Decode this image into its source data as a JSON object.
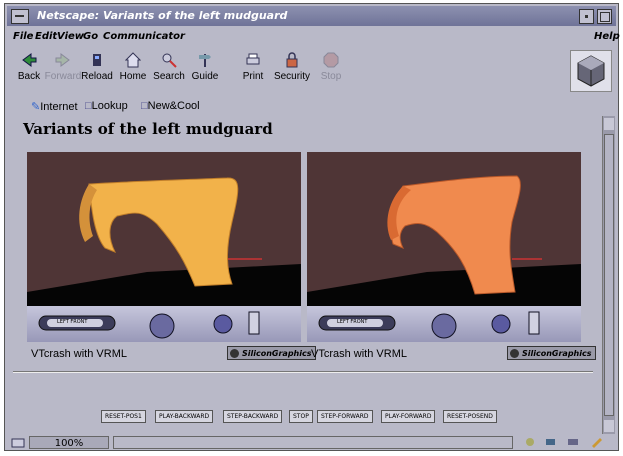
{
  "window": {
    "title": "Netscape: Variants of the left mudguard"
  },
  "menu": {
    "file": "File",
    "edit": "Edit",
    "view": "View",
    "go": "Go",
    "communicator": "Communicator",
    "help": "Help"
  },
  "toolbar": {
    "back": "Back",
    "forward": "Forward",
    "reload": "Reload",
    "home": "Home",
    "search": "Search",
    "guide": "Guide",
    "print": "Print",
    "security": "Security",
    "stop": "Stop"
  },
  "personal_toolbar": {
    "internet": "Internet",
    "lookup": "Lookup",
    "new_cool": "New&Cool"
  },
  "page": {
    "heading": "Variants of the left mudguard",
    "viewers": [
      {
        "caption": "VTcrash with VRML",
        "badge": "SiliconGraphics",
        "nav_label": "LEFT FRONT",
        "part_color": "#f2b24a"
      },
      {
        "caption": "VTcrash with VRML",
        "badge": "SiliconGraphics",
        "nav_label": "LEFT FRONT",
        "part_color": "#f08a4e"
      }
    ],
    "controls": [
      "RESET-POS1",
      "PLAY-BACKWARD",
      "STEP-BACKWARD",
      "STOP",
      "STEP-FORWARD",
      "PLAY-FORWARD",
      "RESET-POSEND"
    ]
  },
  "status": {
    "zoom": "100%"
  },
  "colors": {
    "chrome": "#b9b9c8",
    "title_bar": "#7a7ea3",
    "viewer_background": "#4f3536"
  }
}
